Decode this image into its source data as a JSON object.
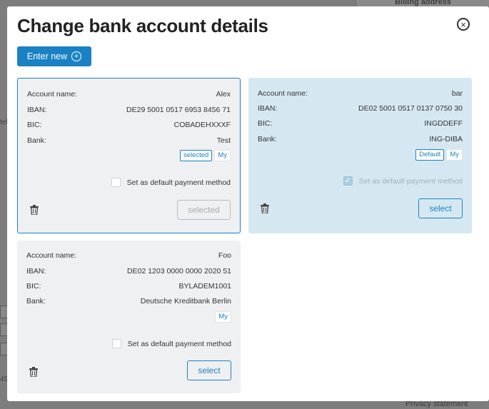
{
  "background": {
    "billing_label": "Billing address",
    "privacy_label": "Privacy statement"
  },
  "modal": {
    "title": "Change bank account details",
    "close_symbol": "×",
    "enter_new_label": "Enter new",
    "enter_new_icon": "plus-circle-icon"
  },
  "labels": {
    "account_name": "Account name:",
    "iban": "IBAN:",
    "bic": "BIC:",
    "bank": "Bank:",
    "default_payment": "Set as default payment method"
  },
  "accounts": [
    {
      "account_name": "Alex",
      "iban": "DE29 5001 0517 6953 8456 71",
      "bic": "COBADEHXXXF",
      "bank": "Test",
      "badges": [
        "selected",
        "My"
      ],
      "default_checked": false,
      "button_label": "selected",
      "state": "selected"
    },
    {
      "account_name": "bar",
      "iban": "DE02 5001 0517 0137 0750 30",
      "bic": "INGDDEFF",
      "bank": "ING-DIBA",
      "badges": [
        "Default",
        "My"
      ],
      "default_checked": true,
      "button_label": "select",
      "state": "default"
    },
    {
      "account_name": "Foo",
      "iban": "DE02 1203 0000 0000 2020 51",
      "bic": "BYLADEM1001",
      "bank": "Deutsche Kreditbank Berlin",
      "badges": [
        "My"
      ],
      "default_checked": false,
      "button_label": "select",
      "state": "normal"
    }
  ],
  "colors": {
    "accent": "#1a82c4",
    "card_bg": "#eef0f2",
    "default_card_bg": "#d5e8f2"
  }
}
